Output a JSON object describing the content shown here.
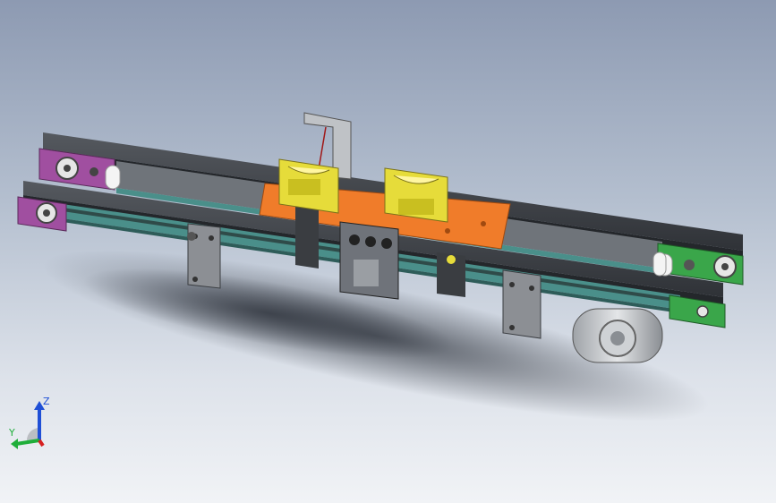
{
  "view": {
    "background_top": "#8d9ab2",
    "background_bottom": "#f1f3f6",
    "model_colors": {
      "frame": "#3a3f45",
      "belt": "#4a8f8a",
      "pallet": "#f07c2a",
      "fixture": "#e6dc3a",
      "end_plate_left": "#a04fa0",
      "end_plate_right": "#3aa64a",
      "bracket": "#8c8f94",
      "motor": "#c9cccf"
    }
  },
  "triad": {
    "z_label": "Z",
    "y_label": "Y",
    "z_color": "#1f4fd6",
    "y_color": "#1fae3a",
    "x_color": "#d62020"
  }
}
